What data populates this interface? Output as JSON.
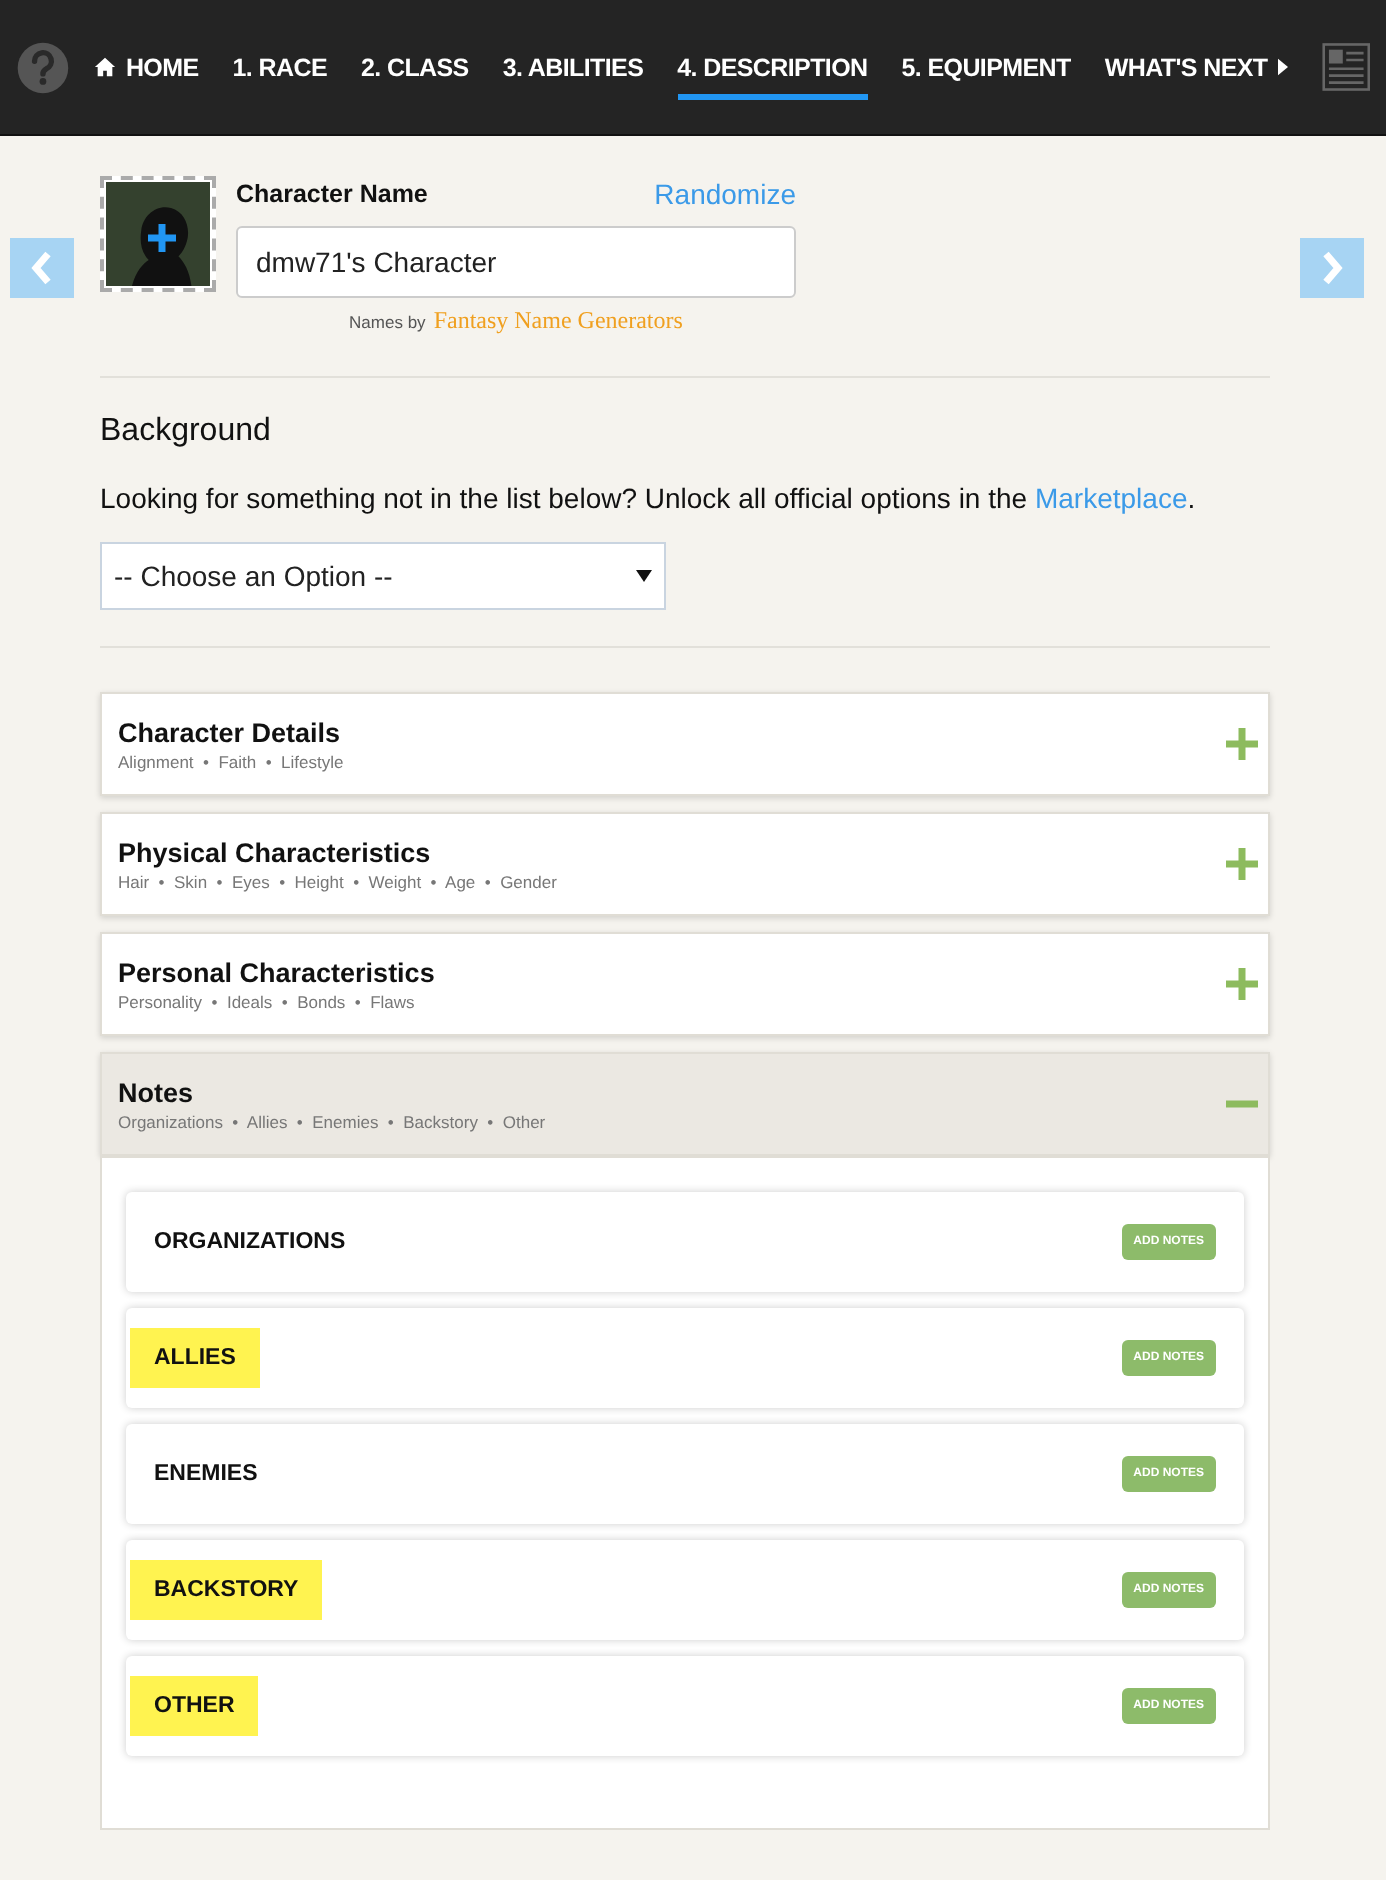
{
  "nav": {
    "items": [
      {
        "label": "HOME",
        "kind": "home",
        "selected": false
      },
      {
        "label": "1. RACE",
        "kind": "step",
        "selected": false
      },
      {
        "label": "2. CLASS",
        "kind": "step",
        "selected": false
      },
      {
        "label": "3. ABILITIES",
        "kind": "step",
        "selected": false
      },
      {
        "label": "4. DESCRIPTION",
        "kind": "step",
        "selected": true
      },
      {
        "label": "5. EQUIPMENT",
        "kind": "step",
        "selected": false
      },
      {
        "label": "WHAT'S NEXT",
        "kind": "next",
        "selected": false
      }
    ]
  },
  "character": {
    "label": "Character Name",
    "randomize": "Randomize",
    "value": "dmw71's Character",
    "credit_prefix": "Names by",
    "credit_brand": "Fantasy Name Generators"
  },
  "background": {
    "heading": "Background",
    "text": "Looking for something not in the list below? Unlock all official options in the",
    "link": "Marketplace",
    "text_end": ".",
    "select": "-- Choose an Option --"
  },
  "sections": [
    {
      "title": "Character Details",
      "subtitle": "Alignment  •  Faith  •  Lifestyle",
      "expanded": false
    },
    {
      "title": "Physical Characteristics",
      "subtitle": "Hair  •  Skin  •  Eyes  •  Height  •  Weight  •  Age  •  Gender",
      "expanded": false
    },
    {
      "title": "Personal Characteristics",
      "subtitle": "Personality  •  Ideals  •  Bonds  •  Flaws",
      "expanded": false
    },
    {
      "title": "Notes",
      "subtitle": "Organizations  •  Allies  •  Enemies  •  Backstory  •  Other",
      "expanded": true,
      "notes": [
        {
          "label": "ORGANIZATIONS",
          "highlighted": false,
          "button": "ADD NOTES"
        },
        {
          "label": "ALLIES",
          "highlighted": true,
          "button": "ADD NOTES"
        },
        {
          "label": "ENEMIES",
          "highlighted": false,
          "button": "ADD NOTES"
        },
        {
          "label": "BACKSTORY",
          "highlighted": true,
          "button": "ADD NOTES"
        },
        {
          "label": "OTHER",
          "highlighted": true,
          "button": "ADD NOTES"
        }
      ]
    }
  ]
}
